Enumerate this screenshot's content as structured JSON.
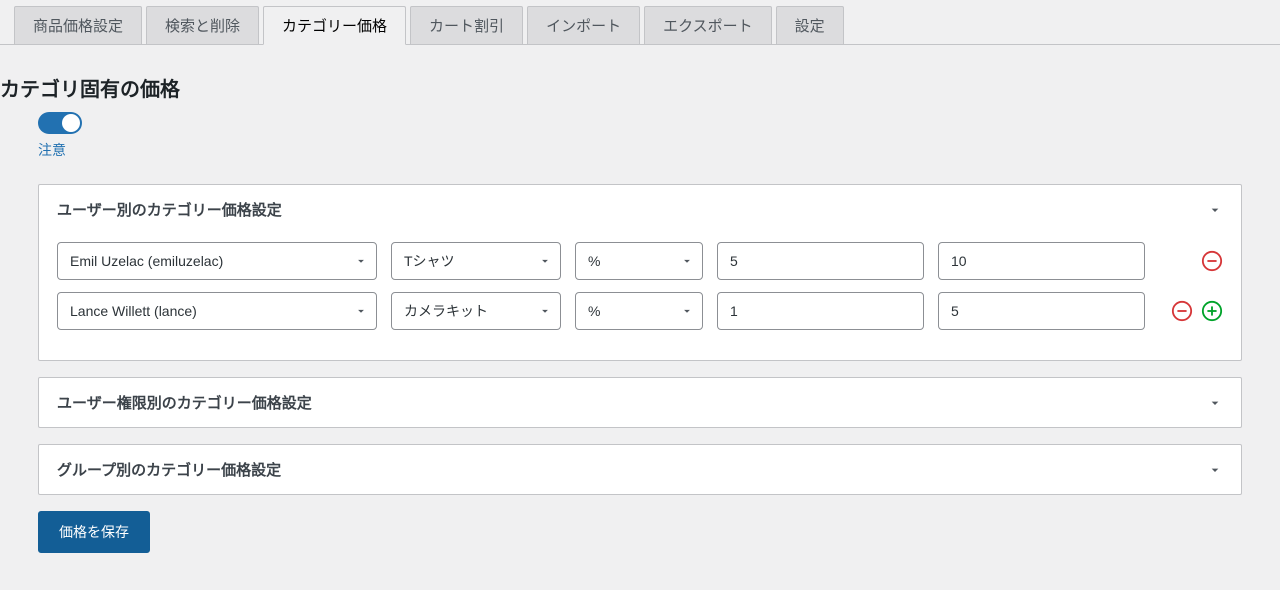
{
  "tabs": [
    {
      "label": "商品価格設定",
      "active": false
    },
    {
      "label": "検索と削除",
      "active": false
    },
    {
      "label": "カテゴリー価格",
      "active": true
    },
    {
      "label": "カート割引",
      "active": false
    },
    {
      "label": "インポート",
      "active": false
    },
    {
      "label": "エクスポート",
      "active": false
    },
    {
      "label": "設定",
      "active": false
    }
  ],
  "page": {
    "title": "カテゴリ固有の価格",
    "note": "注意",
    "save_label": "価格を保存"
  },
  "sections": {
    "by_user": {
      "title": "ユーザー別のカテゴリー価格設定",
      "rows": [
        {
          "user": "Emil Uzelac (emiluzelac)",
          "category": "Tシャツ",
          "unit": "%",
          "val1": "5",
          "val2": "10"
        },
        {
          "user": "Lance Willett (lance)",
          "category": "カメラキット",
          "unit": "%",
          "val1": "1",
          "val2": "5"
        }
      ]
    },
    "by_role": {
      "title": "ユーザー権限別のカテゴリー価格設定"
    },
    "by_group": {
      "title": "グループ別のカテゴリー価格設定"
    }
  }
}
